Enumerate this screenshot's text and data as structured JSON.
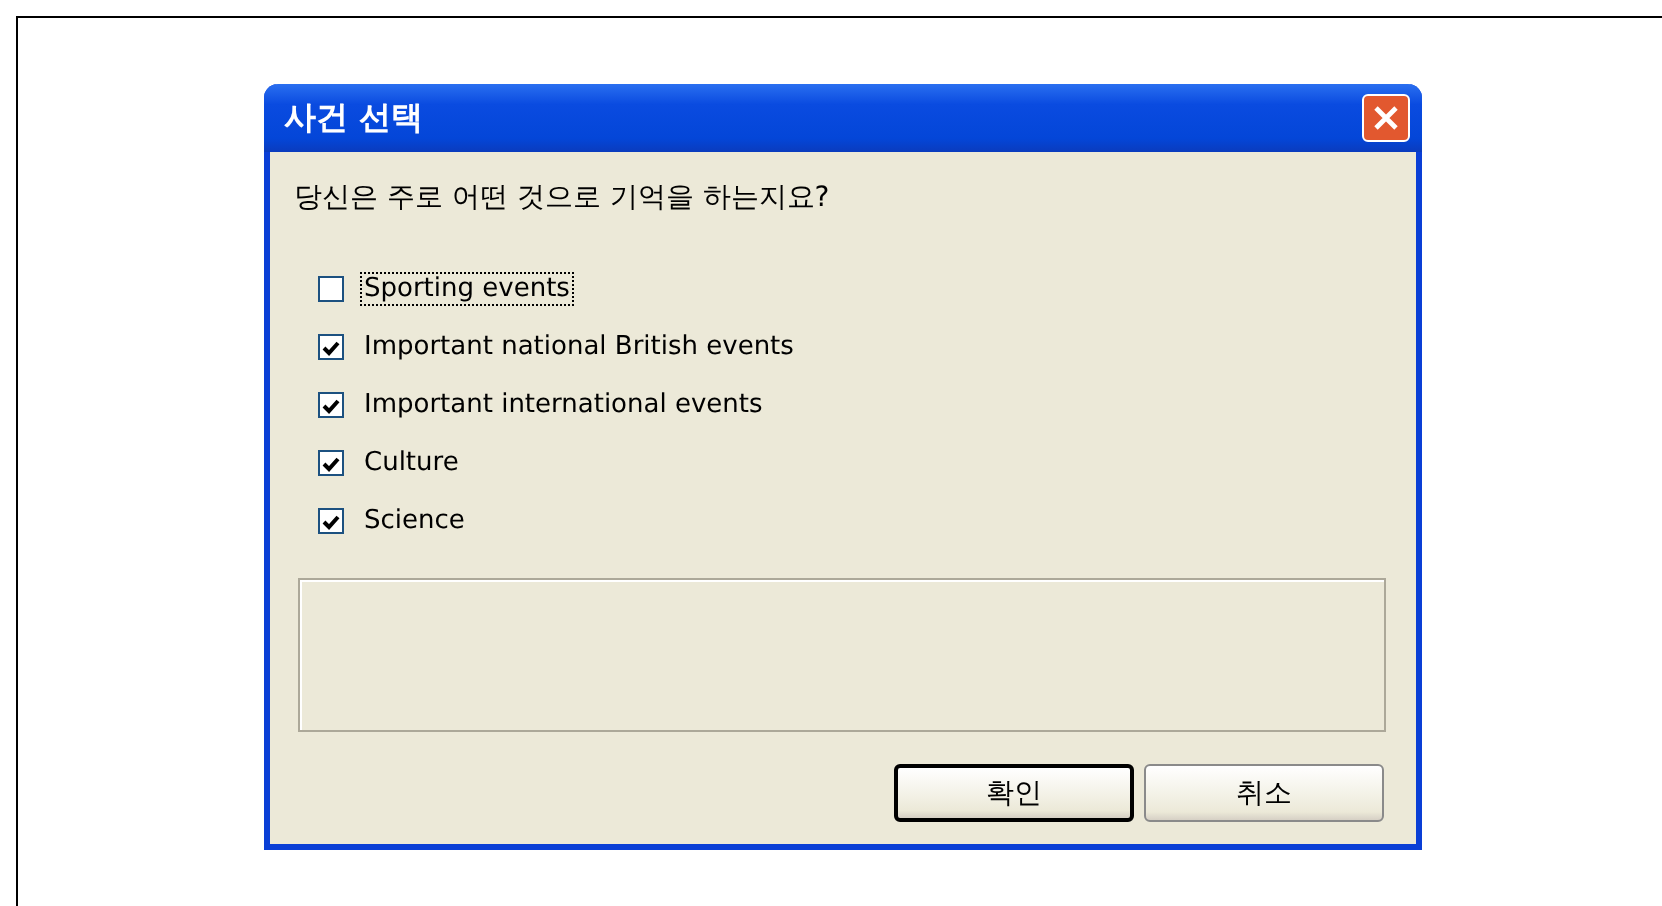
{
  "window": {
    "title": "사건 선택"
  },
  "question": "당신은 주로 어떤 것으로 기억을 하는지요?",
  "options": [
    {
      "label": "Sporting events",
      "checked": false,
      "focused": true
    },
    {
      "label": "Important national British events",
      "checked": true,
      "focused": false
    },
    {
      "label": "Important international events",
      "checked": true,
      "focused": false
    },
    {
      "label": "Culture",
      "checked": true,
      "focused": false
    },
    {
      "label": "Science",
      "checked": true,
      "focused": false
    }
  ],
  "buttons": [
    {
      "label": "확인",
      "default": true
    },
    {
      "label": "취소",
      "default": false
    }
  ]
}
